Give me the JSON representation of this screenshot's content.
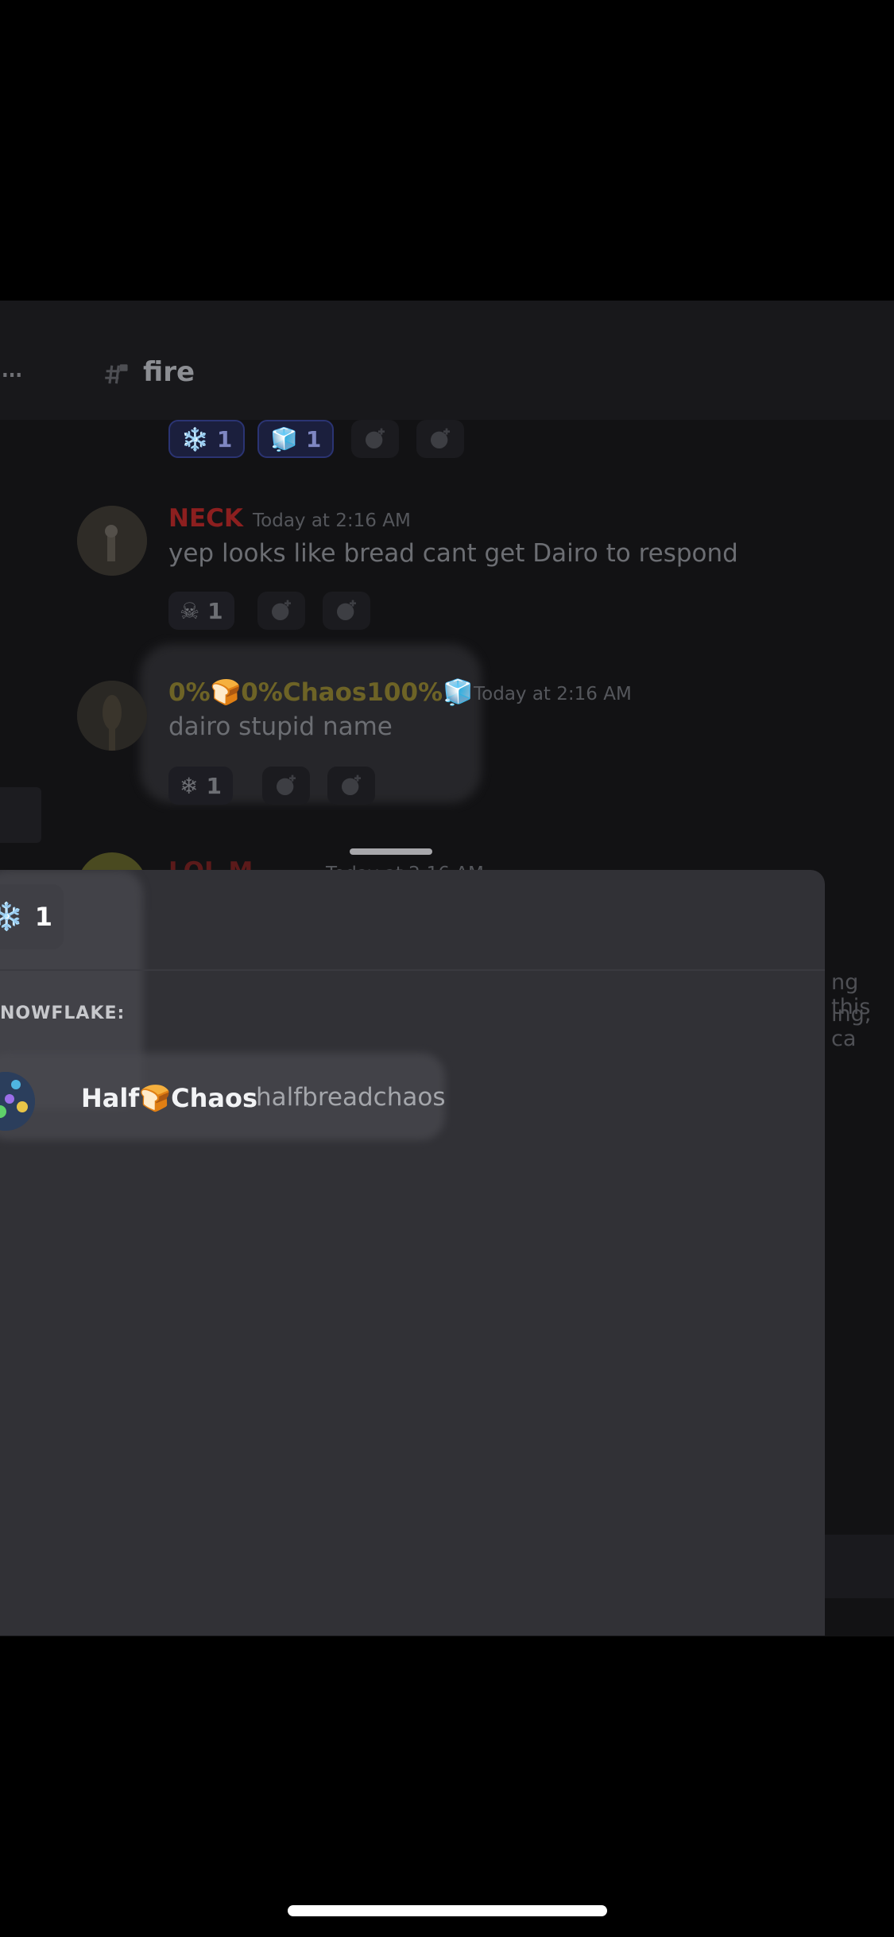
{
  "channel": {
    "name": "fire",
    "more": "..."
  },
  "messages": [
    {
      "reactions": [
        {
          "emoji": "❄️",
          "count": "1",
          "highlighted": true
        },
        {
          "emoji": "🧊",
          "count": "1",
          "highlighted": true
        }
      ]
    },
    {
      "username": "NECK",
      "username_color": "#8c1f1f",
      "timestamp": "Today at 2:16 AM",
      "text": "yep looks like bread cant get Dairo to respond",
      "reactions": [
        {
          "emoji": "☠",
          "count": "1"
        }
      ]
    },
    {
      "username": "0%🍞0%Chaos100%🧊",
      "username_color": "#6d6326",
      "timestamp": "Today at 2:16 AM",
      "text": "dairo stupid name",
      "reactions": [
        {
          "emoji": "❄",
          "count": "1"
        }
      ]
    },
    {
      "username": "LOL M",
      "username_color": "#5b1a1a",
      "timestamp": "Today at 2:16 AM"
    }
  ],
  "peek_text": {
    "line1": "ng this",
    "line2": "ing, ca"
  },
  "sheet": {
    "tab": {
      "emoji": "❄️",
      "count": "1"
    },
    "section_label": "NOWFLAKE:",
    "users": [
      {
        "display_name": "Half🍞Chaos",
        "handle": "halfbreadchaos"
      }
    ]
  }
}
